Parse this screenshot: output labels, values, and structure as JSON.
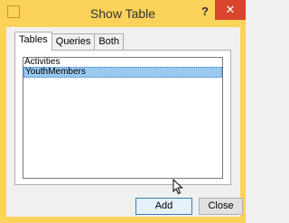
{
  "window": {
    "title": "Show Table",
    "help_label": "?",
    "close_label": "✕"
  },
  "tabs": [
    {
      "label": "Tables",
      "active": true
    },
    {
      "label": "Queries",
      "active": false
    },
    {
      "label": "Both",
      "active": false
    }
  ],
  "list": {
    "items": [
      {
        "label": "Activities",
        "selected": false
      },
      {
        "label": "YouthMembers",
        "selected": true
      }
    ]
  },
  "buttons": {
    "add_label": "Add",
    "close_label": "Close"
  },
  "colors": {
    "frame": "#fbd35a",
    "close_button": "#d9442c",
    "selection": "#99c9ef"
  },
  "icons": {
    "cursor": "mouse-pointer-icon",
    "app": "window-icon"
  }
}
